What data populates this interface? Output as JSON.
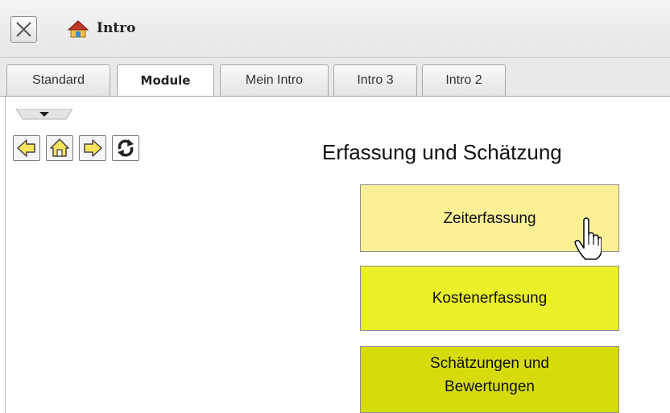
{
  "window": {
    "title": "Intro"
  },
  "tabs": [
    {
      "label": "Standard",
      "active": false
    },
    {
      "label": "Module",
      "active": true
    },
    {
      "label": "Mein Intro",
      "active": false
    },
    {
      "label": "Intro 3",
      "active": false
    },
    {
      "label": "Intro 2",
      "active": false
    }
  ],
  "toolbar": {
    "icons": [
      "arrow-left-icon",
      "home-icon",
      "arrow-right-icon",
      "refresh-icon"
    ]
  },
  "main": {
    "heading": "Erfassung und Schätzung",
    "buttons": [
      {
        "label": "Zeiterfassung",
        "color": "#fbf096",
        "hovered": true
      },
      {
        "label": "Kostenerfassung",
        "color": "#eaf12b"
      },
      {
        "label": "Schätzungen und Bewertungen",
        "color": "#d6dc0c"
      }
    ]
  },
  "colors": {
    "icon_fill": "#f8e35c",
    "icon_stroke": "#444444"
  }
}
